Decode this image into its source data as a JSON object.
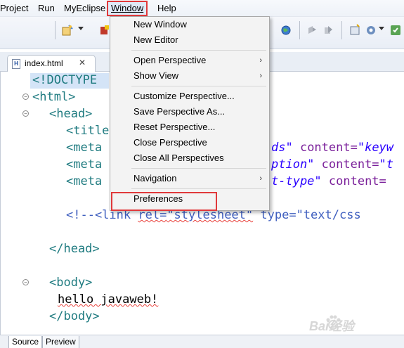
{
  "menubar": {
    "items": [
      {
        "label": "Project"
      },
      {
        "label": "Run"
      },
      {
        "label": "MyEclipse"
      },
      {
        "label": "Window"
      },
      {
        "label": "Help"
      }
    ]
  },
  "editor": {
    "tab_label": "index.html",
    "file_icon_letter": "H"
  },
  "window_menu": {
    "items": [
      {
        "label": "New Window",
        "submenu": false
      },
      {
        "label": "New Editor",
        "submenu": false
      },
      {
        "label": "Open Perspective",
        "submenu": true
      },
      {
        "label": "Show View",
        "submenu": true
      },
      {
        "label": "Customize Perspective...",
        "submenu": false
      },
      {
        "label": "Save Perspective As...",
        "submenu": false
      },
      {
        "label": "Reset Perspective...",
        "submenu": false
      },
      {
        "label": "Close Perspective",
        "submenu": false
      },
      {
        "label": "Close All Perspectives",
        "submenu": false
      },
      {
        "label": "Navigation",
        "submenu": true
      },
      {
        "label": "Preferences",
        "submenu": false
      }
    ],
    "submenu_arrow": "›"
  },
  "code": {
    "l1": "<!DOCTYPE",
    "l2": "<html>",
    "l3": "<head>",
    "l4": "<title",
    "l5a": "<meta",
    "l5b": "ds\"",
    "l5c": " content=",
    "l5d": "\"keyw",
    "l6a": "<meta",
    "l6b": "ption\"",
    "l6c": " content=",
    "l6d": "\"t",
    "l7a": "<meta",
    "l7b": "t-type\"",
    "l7c": " content=",
    "l8a": "<!--<link ",
    "l8b": "rel=",
    "l8c": "\"stylesheet\"",
    "l8d": " type=",
    "l8e": "\"text/css",
    "l9": "</head>",
    "l10": "<body>",
    "l11": "hello javaweb!",
    "l12": "</body>"
  },
  "bottom_tabs": {
    "source": "Source",
    "preview": "Preview"
  },
  "watermark": {
    "text": "Bai经验",
    "icon": "baidu-paw-icon"
  }
}
